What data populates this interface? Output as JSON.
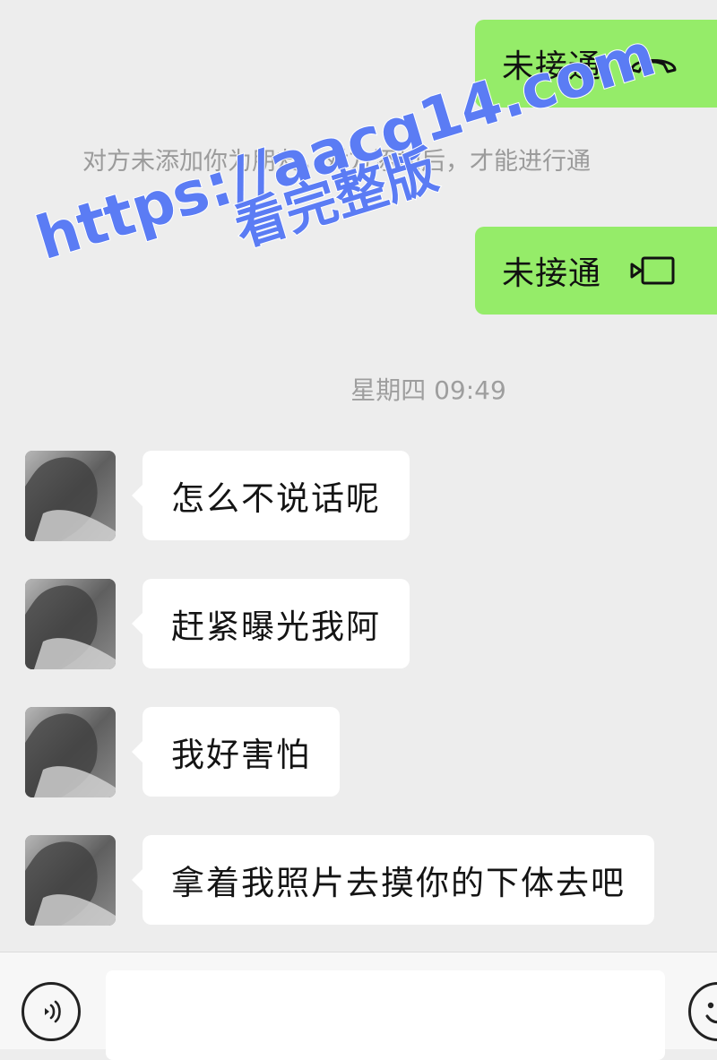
{
  "messages": {
    "call_voice": {
      "label": "未接通",
      "icon": "phone-hangup-icon"
    },
    "system_note": "对方未添加你为朋友。对方添加后，才能进行通",
    "call_video": {
      "label": "未接通",
      "icon": "video-camera-icon"
    },
    "timestamp": "星期四 09:49",
    "incoming": [
      {
        "text": "怎么不说话呢"
      },
      {
        "text": "赶紧曝光我阿"
      },
      {
        "text": "我好害怕"
      },
      {
        "text": "拿着我照片去摸你的下体去吧"
      }
    ]
  },
  "watermark": {
    "url": "https://aacg14.com",
    "caption": "看完整版",
    "color": "#5b7cf4"
  },
  "input_bar": {
    "text_value": "",
    "voice_icon": "voice-icon",
    "emoji_icon": "emoji-icon"
  },
  "colors": {
    "outgoing_bubble": "#95ec69",
    "incoming_bubble": "#ffffff",
    "background": "#ededed"
  }
}
